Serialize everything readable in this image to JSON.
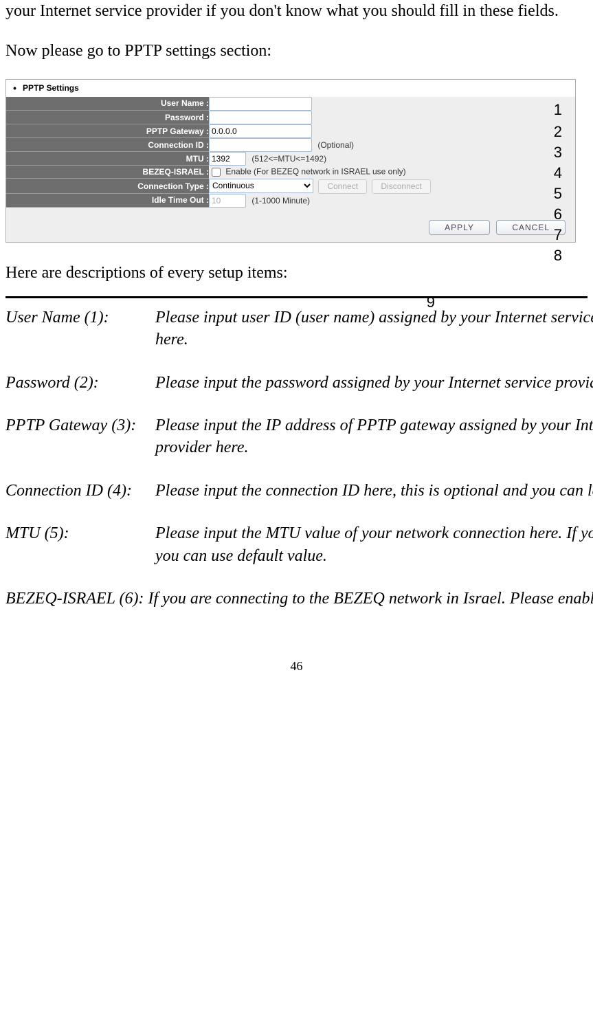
{
  "intro": {
    "p1": "your Internet service provider if you don't know what you should fill in these fields.",
    "p2": "Now please go to PPTP settings section:"
  },
  "screenshot": {
    "title": "PPTP Settings",
    "rows": {
      "username": {
        "label": "User Name :"
      },
      "password": {
        "label": "Password :"
      },
      "gateway": {
        "label": "PPTP Gateway :",
        "value": "0.0.0.0"
      },
      "connid": {
        "label": "Connection ID :",
        "hint": "(Optional)"
      },
      "mtu": {
        "label": "MTU :",
        "value": "1392",
        "hint": "(512<=MTU<=1492)"
      },
      "bezeq": {
        "label": "BEZEQ-ISRAEL :",
        "hint": "Enable (For BEZEQ network in ISRAEL use only)"
      },
      "conntype": {
        "label": "Connection Type :",
        "value": "Continuous",
        "connect": "Connect",
        "disconnect": "Disconnect"
      },
      "idle": {
        "label": "Idle Time Out :",
        "value": "10",
        "hint": "(1-1000 Minute)"
      }
    },
    "actions": {
      "apply": "APPLY",
      "cancel": "CANCEL"
    }
  },
  "callouts": {
    "1": "1",
    "2": "2",
    "3": "3",
    "4": "4",
    "5": "5",
    "6": "6",
    "7": "7",
    "8": "8",
    "9": "9"
  },
  "descriptions": {
    "intro": "Here are descriptions of every setup items:",
    "items": [
      {
        "term": "User Name (1):",
        "def": "Please input user ID (user name) assigned by your Internet service provider here."
      },
      {
        "term": "Password (2):",
        "def": "Please input the password assigned by your Internet service provider here."
      },
      {
        "term": "PPTP Gateway (3):",
        "def": "Please input the IP address of PPTP gateway assigned by your Internet service provider here."
      },
      {
        "term": "Connection ID (4):",
        "def": "Please input the connection ID here, this is optional and you can leave it blank."
      },
      {
        "term": "MTU (5):",
        "def": "Please input the MTU value of your network connection here. If you don't know, you can use default value."
      },
      {
        "term": "BEZEQ-ISRAEL (6):",
        "def": "If you are connecting to the BEZEQ network in Israel. Please enable this function."
      }
    ]
  },
  "page_number": "46"
}
